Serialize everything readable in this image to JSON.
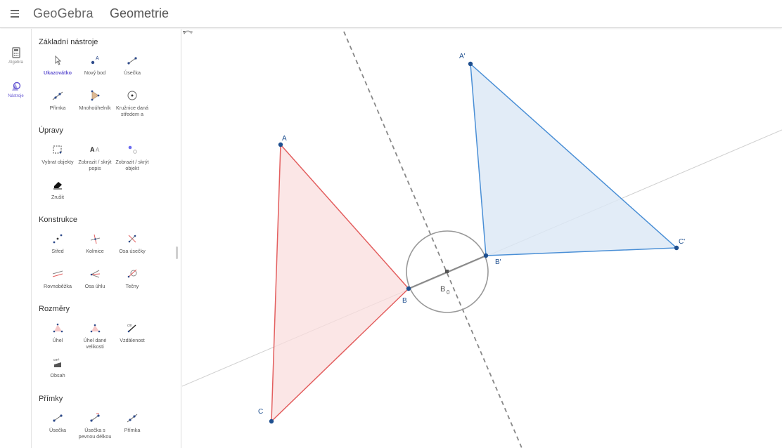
{
  "header": {
    "logo": "GeoGebra",
    "app_title": "Geometrie"
  },
  "rail": [
    {
      "label": "Algebra",
      "icon": "calculator-icon"
    },
    {
      "label": "Nástroje",
      "icon": "tools-icon"
    }
  ],
  "panel": {
    "sections": [
      {
        "title": "Základní nástroje"
      },
      {
        "title": "Úpravy"
      },
      {
        "title": "Konstrukce"
      },
      {
        "title": "Rozměry"
      },
      {
        "title": "Přímky"
      }
    ],
    "tools": {
      "basic": [
        "Ukazovátko",
        "Nový bod",
        "Úsečka",
        "Přímka",
        "Mnohoúhelník",
        "Kružnice daná středem a"
      ],
      "edit": [
        "Vybrat objekty",
        "Zobrazit / skrýt popis",
        "Zobrazit / skrýt objekt",
        "Zrušit"
      ],
      "construct": [
        "Střed",
        "Kolmice",
        "Osa úsečky",
        "Rovnoběžka",
        "Osa úhlu",
        "Tečny"
      ],
      "measure": [
        "Úhel",
        "Úhel dané velikosti",
        "Vzdálenost",
        "Obsah"
      ],
      "lines": [
        "Úsečka",
        "Úsečka s pevnou délkou",
        "Přímka"
      ]
    },
    "selected_tool": "Ukazovátko",
    "extra_line": "středem a"
  },
  "canvas": {
    "points": {
      "A": "A",
      "B": "B",
      "C": "C",
      "A1": "A'",
      "B1": "B'",
      "C1": "C'",
      "B0": "B",
      "B0_sub": "0"
    },
    "colors": {
      "red": "#e35f5f",
      "blue": "#4a8fd6",
      "gray": "#888888",
      "accent": "#6557d2"
    }
  }
}
